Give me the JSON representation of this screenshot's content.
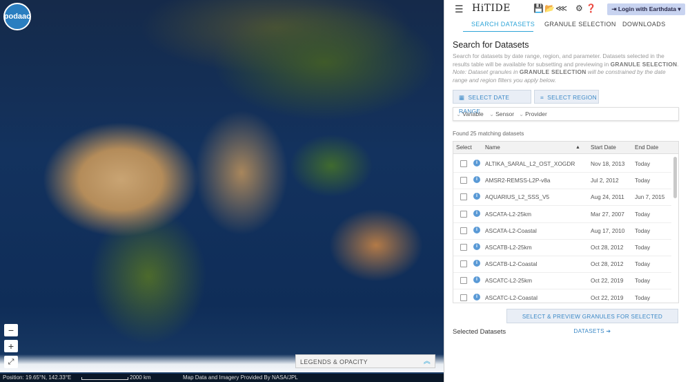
{
  "map": {
    "logo_text": "podaac",
    "zoom_out": "−",
    "zoom_in": "+",
    "fullscreen": "⤢",
    "legend_label": "LEGENDS & OPACITY",
    "legend_chevron": "︽",
    "position_label": "Position:  19.65°N, 142.33°E",
    "scale_label": "2000 km",
    "credit": "Map Data and Imagery Provided By NASA/JPL"
  },
  "header": {
    "menu_icon": "☰",
    "title": "HiTIDE",
    "save_icon": "💾",
    "folder_icon": "📂",
    "share_icon": "⋘",
    "settings_icon": "⚙",
    "help_icon": "❓",
    "login_label": "Login with Earthdata",
    "login_icon": "⇥",
    "login_caret": "▾"
  },
  "tabs": [
    {
      "label": "SEARCH DATASETS"
    },
    {
      "label": "GRANULE SELECTION"
    },
    {
      "label": "DOWNLOADS"
    }
  ],
  "search": {
    "heading": "Search for Datasets",
    "desc_1": "Search for datasets by date range, region, and parameter. Datasets selected in the results table will be available for subsetting and previewing in ",
    "desc_strong_1": "GRANULE SELECTION",
    "desc_2": ".",
    "desc_note_1": "Note: Dataset granules in ",
    "desc_strong_2": "GRANULE SELECTION",
    "desc_note_2": " will be constrained by the date range and region filters you apply below.",
    "date_button": "SELECT DATE RANGE",
    "date_icon": "▦",
    "region_button": "SELECT REGION",
    "region_icon": "⌗",
    "filters": [
      {
        "label": "Variable"
      },
      {
        "label": "Sensor"
      },
      {
        "label": "Provider"
      }
    ],
    "filter_chevron": "⌄",
    "found_text": "Found 25 matching datasets"
  },
  "table": {
    "headers": {
      "select": "Select",
      "name": "Name",
      "start": "Start Date",
      "end": "End Date",
      "sort": "▲"
    },
    "rows": [
      {
        "name": "ALTIKA_SARAL_L2_OST_XOGDR",
        "start": "Nov 18, 2013",
        "end": "Today"
      },
      {
        "name": "AMSR2-REMSS-L2P-v8a",
        "start": "Jul 2, 2012",
        "end": "Today"
      },
      {
        "name": "AQUARIUS_L2_SSS_V5",
        "start": "Aug 24, 2011",
        "end": "Jun 7, 2015"
      },
      {
        "name": "ASCATA-L2-25km",
        "start": "Mar 27, 2007",
        "end": "Today"
      },
      {
        "name": "ASCATA-L2-Coastal",
        "start": "Aug 17, 2010",
        "end": "Today"
      },
      {
        "name": "ASCATB-L2-25km",
        "start": "Oct 28, 2012",
        "end": "Today"
      },
      {
        "name": "ASCATB-L2-Coastal",
        "start": "Oct 28, 2012",
        "end": "Today"
      },
      {
        "name": "ASCATC-L2-25km",
        "start": "Oct 22, 2019",
        "end": "Today"
      },
      {
        "name": "ASCATC-L2-Coastal",
        "start": "Oct 22, 2019",
        "end": "Today"
      }
    ],
    "info_glyph": "i"
  },
  "actions": {
    "select_preview": "SELECT & PREVIEW GRANULES FOR SELECTED DATASETS ➔",
    "selected_heading": "Selected Datasets"
  }
}
